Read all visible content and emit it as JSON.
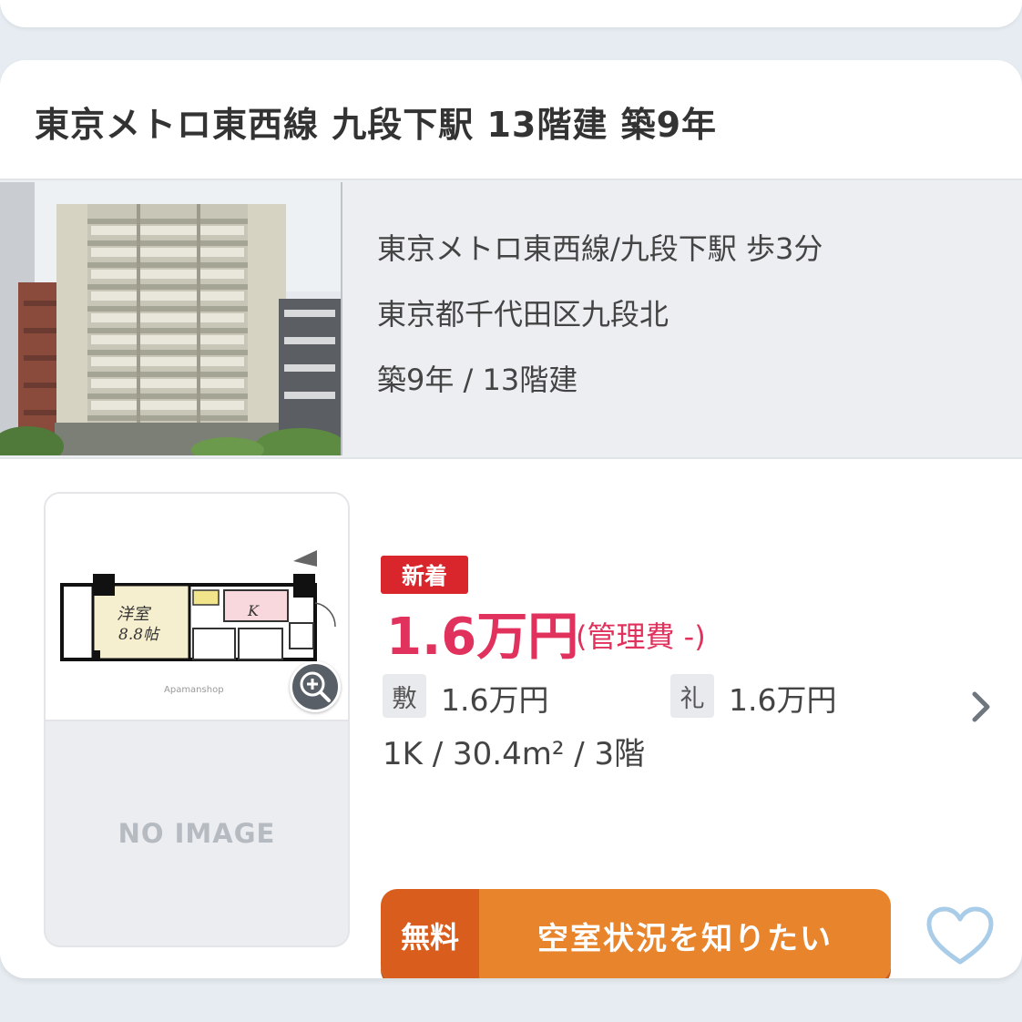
{
  "property": {
    "title": "東京メトロ東西線 九段下駅 13階建 築9年",
    "access": "東京メトロ東西線/九段下駅 歩3分",
    "address": "東京都千代田区九段北",
    "age_floors": "築9年 / 13階建"
  },
  "room": {
    "badge": "新着",
    "rent": "1.6万円",
    "management_fee": "(管理費 -)",
    "deposit_label": "敷",
    "deposit_value": "1.6万円",
    "key_money_label": "礼",
    "key_money_value": "1.6万円",
    "layout_info": "1K / 30.4m² / 3階",
    "floorplan_room_label": "洋室",
    "floorplan_size_label": "8.8帖",
    "floorplan_kitchen_label": "K",
    "floorplan_credit": "Apamanshop",
    "no_image_text": "NO IMAGE"
  },
  "cta": {
    "free_label": "無料",
    "main_label": "空室状況を知りたい"
  },
  "icons": {
    "zoom": "zoom-in-icon",
    "chevron": "chevron-right-icon",
    "favorite": "heart-outline-icon"
  },
  "colors": {
    "price": "#e0325d",
    "badge": "#d8262c",
    "cta_free": "#d95e1e",
    "cta_main": "#e8842c",
    "heart": "#a9cce8"
  }
}
